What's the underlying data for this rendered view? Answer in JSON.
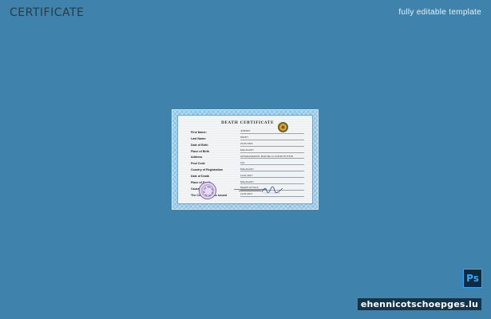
{
  "header": {
    "title": "CERTIFICATE",
    "tagline": "fully editable template"
  },
  "certificate": {
    "heading": "DEATH CERTIFICATE",
    "fields": [
      {
        "label": "First Name:",
        "value": "JOHNNY"
      },
      {
        "label": "Last Name:",
        "value": "SMITH"
      },
      {
        "label": "Date of Birth",
        "value": "20.05.1963"
      },
      {
        "label": "Place of Birth",
        "value": "MALAGASY"
      },
      {
        "label": "Address",
        "value": "ANTANANARIVO, RUE DE LA CONSTITUTION"
      },
      {
        "label": "Post Code",
        "value": "101"
      },
      {
        "label": "Country of Registration",
        "value": "MALAGASY"
      },
      {
        "label": "Date of Death",
        "value": "12.01.2017"
      },
      {
        "label": "Place of Death",
        "value": "MALAGASY"
      },
      {
        "label": "Causes of Death",
        "value": "HEART ATTACK"
      },
      {
        "label": "The Certificate was issued",
        "value": "12.02.2017"
      }
    ]
  },
  "badges": {
    "photoshop": "Ps",
    "watermark": "ehennicotschoepges.lu"
  }
}
